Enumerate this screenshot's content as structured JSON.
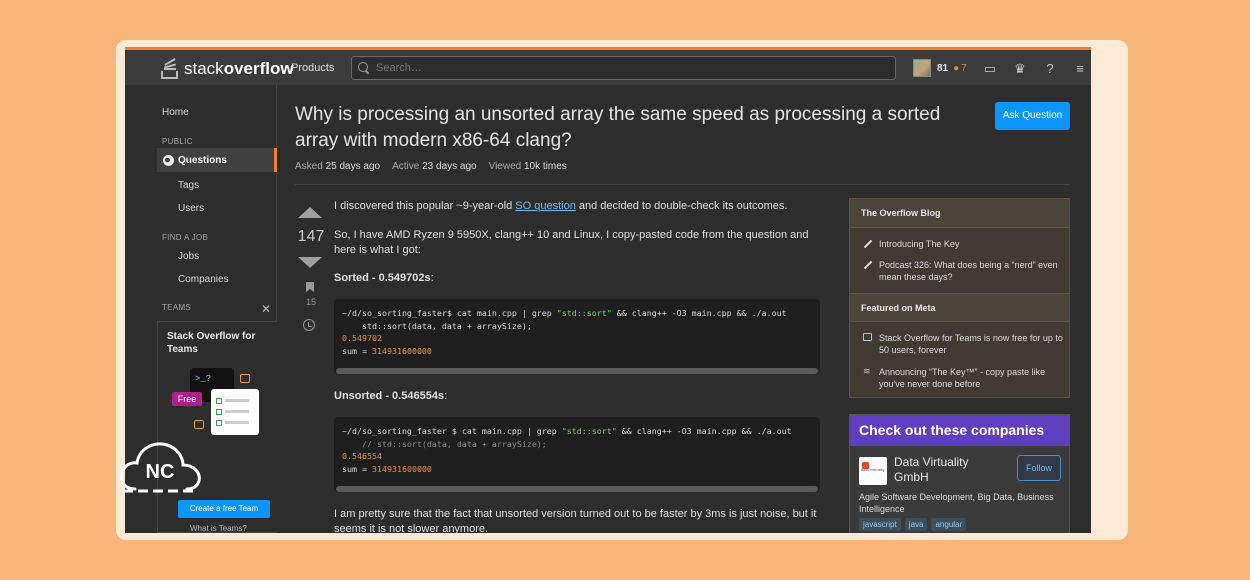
{
  "header": {
    "logo_word1": "stack",
    "logo_word2": "overflow",
    "products": "Products",
    "search_placeholder": "Search…",
    "reputation": "81",
    "bronze_count": "7"
  },
  "sidebar": {
    "home": "Home",
    "public_head": "PUBLIC",
    "questions": "Questions",
    "tags": "Tags",
    "users": "Users",
    "find_job_head": "FIND A JOB",
    "jobs": "Jobs",
    "companies": "Companies",
    "teams_head": "TEAMS",
    "teams_title": "Stack Overflow for Teams",
    "free_label": "Free",
    "terminal_text": ">_?",
    "create_team": "Create a free Team",
    "what_teams": "What is Teams?"
  },
  "question": {
    "title": "Why is processing an unsorted array the same speed as processing a sorted array with modern x86-64 clang?",
    "ask_button": "Ask Question",
    "asked_label": "Asked",
    "asked_value": "25 days ago",
    "active_label": "Active",
    "active_value": "23 days ago",
    "viewed_label": "Viewed",
    "viewed_value": "10k times",
    "votes": "147",
    "bookmarks": "15"
  },
  "post": {
    "p1_before": "I discovered this popular ~9-year-old ",
    "p1_link": "SO question",
    "p1_after": " and decided to double-check its outcomes.",
    "p2": "So, I have AMD Ryzen 9 5950X, clang++ 10 and Linux, I copy-pasted code from the question and here is what I got:",
    "sorted_heading": "Sorted - 0.549702s",
    "sorted_suffix": ":",
    "code1_l1a": "~/d/so_sorting_faster$ cat main.cpp | grep ",
    "code1_l1s": "\"std::sort\"",
    "code1_l1b": " && clang++ -O3 main.cpp && ./a.out",
    "code1_l2": "    std::sort(data, data + arraySize);",
    "code1_l3": "0.549702",
    "code1_l4a": "sum = ",
    "code1_l4n": "314931600000",
    "unsorted_heading": "Unsorted - 0.546554s",
    "unsorted_suffix": ":",
    "code2_l1a": "~/d/so_sorting_faster $ cat main.cpp | grep ",
    "code2_l1s": "\"std::sort\"",
    "code2_l1b": " && clang++ -O3 main.cpp && ./a.out",
    "code2_l2": "    // std::sort(data, data + arraySize);",
    "code2_l3": "0.546554",
    "code2_l4a": "sum = ",
    "code2_l4n": "314931600000",
    "p3": "I am pretty sure that the fact that unsorted version turned out to be faster by 3ms is just noise, but it seems it is not slower anymore."
  },
  "blog": {
    "head": "The Overflow Blog",
    "item1": "Introducing The Key",
    "item2": "Podcast 326: What does being a “nerd” even mean these days?",
    "meta_head": "Featured on Meta",
    "item3": "Stack Overflow for Teams is now free for up to 50 users, forever",
    "item4": "Announcing “The Key™” - copy paste like you've never done before"
  },
  "companies": {
    "head_a": "Check out these ",
    "head_b": "companies",
    "logo_text": "data virtuality",
    "name": "Data Virtuality GmbH",
    "follow": "Follow",
    "desc": "Agile Software Development, Big Data, Business Intelligence",
    "tags": [
      "javascript",
      "java",
      "angular"
    ]
  },
  "watermark": {
    "text": "NC"
  },
  "colors": {
    "accent": "#f48024",
    "link": "#6cbbf7",
    "button": "#0a95ff",
    "companies_header": "#5d3fbf",
    "page_bg": "#f7b67a"
  }
}
